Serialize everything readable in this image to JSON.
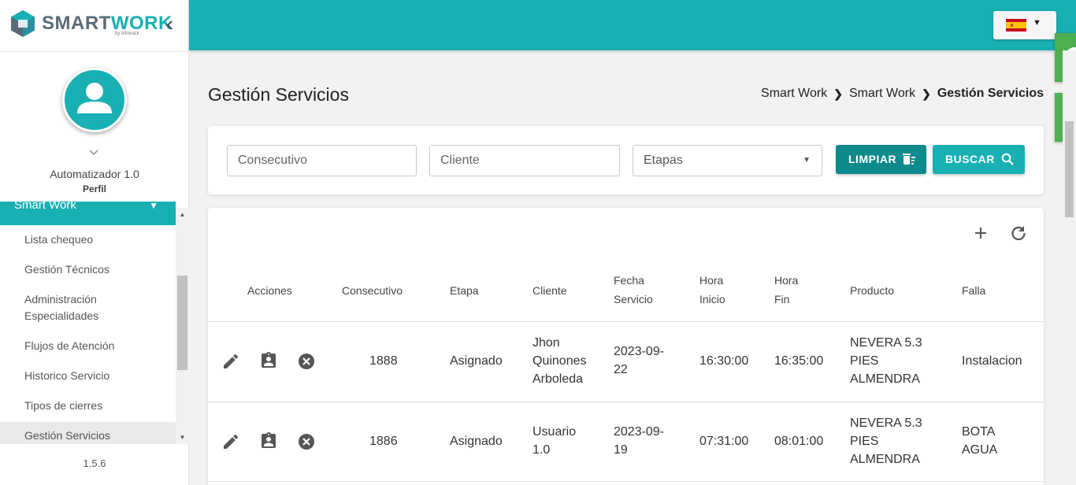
{
  "app": {
    "logo_smart": "SMART",
    "logo_work": "WORK",
    "logo_sub": "by infotrack",
    "version": "1.5.6"
  },
  "profile": {
    "name": "Automatizador 1.0",
    "role": "Perfil"
  },
  "sidebar": {
    "group": "Smart Work",
    "items": [
      {
        "label": "Lista chequeo"
      },
      {
        "label": "Gestión Técnicos"
      },
      {
        "label": "Administración Especialidades"
      },
      {
        "label": "Flujos de Atención"
      },
      {
        "label": "Historico Servicio"
      },
      {
        "label": "Tipos de cierres"
      },
      {
        "label": "Gestión Servicios"
      }
    ]
  },
  "page": {
    "title": "Gestión Servicios",
    "breadcrumb": [
      "Smart Work",
      "Smart Work",
      "Gestión Servicios"
    ]
  },
  "filters": {
    "consecutivo_placeholder": "Consecutivo",
    "cliente_placeholder": "Cliente",
    "etapas_value": "Etapas",
    "clear_label": "LIMPIAR",
    "search_label": "BUSCAR"
  },
  "table": {
    "headers": {
      "acciones": "Acciones",
      "consecutivo": "Consecutivo",
      "etapa": "Etapa",
      "cliente": "Cliente",
      "fecha_1": "Fecha",
      "fecha_2": "Servicio",
      "inicio_1": "Hora",
      "inicio_2": "Inicio",
      "fin_1": "Hora",
      "fin_2": "Fin",
      "producto": "Producto",
      "falla": "Falla"
    },
    "rows": [
      {
        "consecutivo": "1888",
        "etapa": "Asignado",
        "cliente": [
          "Jhon",
          "Quinones",
          "Arboleda"
        ],
        "fecha": [
          "2023-09-",
          "22"
        ],
        "hora_inicio": "16:30:00",
        "hora_fin": "16:35:00",
        "producto": [
          "NEVERA 5.3",
          "PIES",
          "ALMENDRA"
        ],
        "falla": [
          "Instalacion"
        ]
      },
      {
        "consecutivo": "1886",
        "etapa": "Asignado",
        "cliente": [
          "Usuario",
          "1.0"
        ],
        "fecha": [
          "2023-09-",
          "19"
        ],
        "hora_inicio": "07:31:00",
        "hora_fin": "08:01:00",
        "producto": [
          "NEVERA 5.3",
          "PIES",
          "ALMENDRA"
        ],
        "falla": [
          "BOTA",
          "AGUA"
        ]
      }
    ]
  },
  "colors": {
    "primary": "#18b0b3",
    "dark_button": "#0e8a8c",
    "toast": "#4caf50"
  },
  "icons": {
    "language": "spain-flag-icon",
    "add": "plus-icon",
    "refresh": "refresh-icon",
    "edit": "pencil-icon",
    "assign": "clipboard-user-icon",
    "cancel": "close-circle-icon"
  }
}
